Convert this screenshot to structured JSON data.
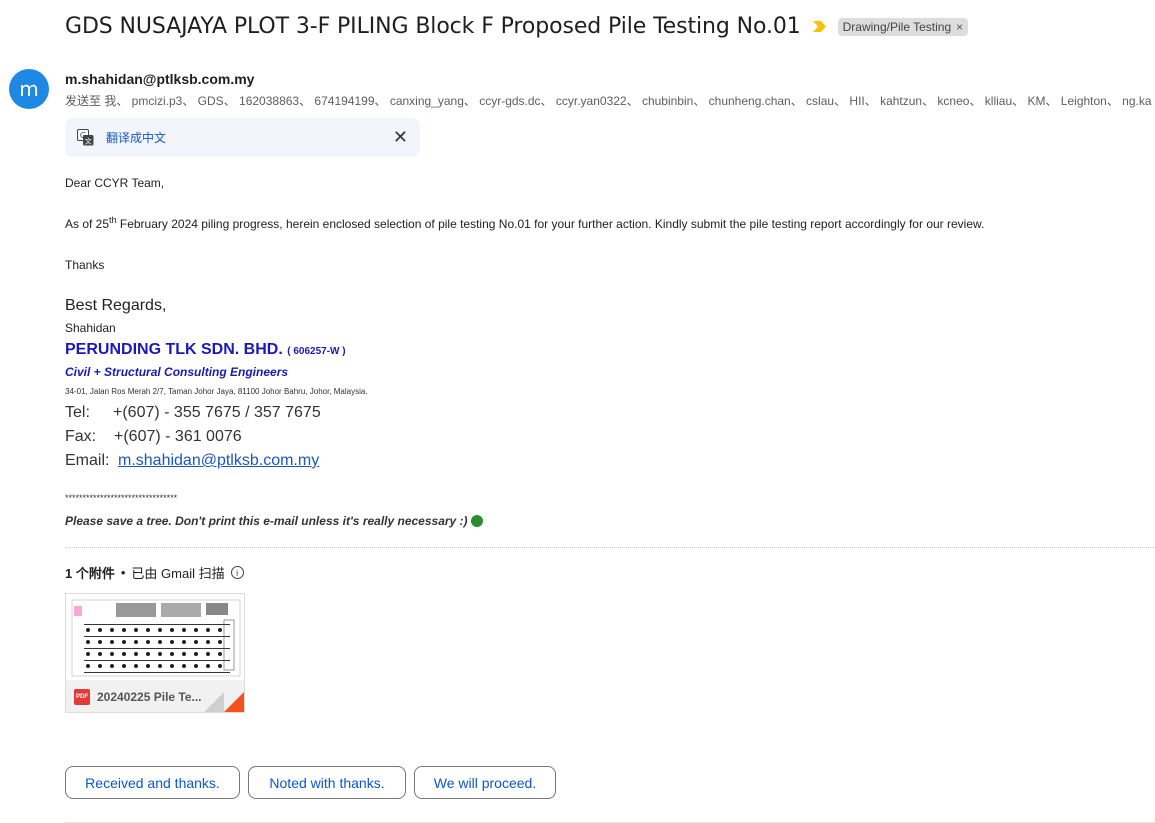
{
  "subject": "GDS NUSAJAYA PLOT 3-F PILING Block F Proposed Pile Testing No.01",
  "label": {
    "text": "Drawing/Pile Testing",
    "remove": "×"
  },
  "avatar_letter": "m",
  "sender": "m.shahidan@ptlksb.com.my",
  "recipients_line": "发送至 我、 pmcizi.p3、 GDS、 162038863、 674194199、 canxing_yang、 ccyr-gds.dc、 ccyr.yan0322、 chubinbin、 chunheng.chan、 cslau、 HII、 kahtzun、 kcneo、 klliau、 KM、 Leighton、 ng.ka",
  "translate": {
    "label": "翻译成中文",
    "close": "✕"
  },
  "body": {
    "greeting": "Dear CCYR Team,",
    "para_pre": "As of 25",
    "para_sup": "th",
    "para_post": " February 2024 piling progress, herein enclosed selection of pile testing No.01 for your further action. Kindly submit the pile testing report accordingly for our review.",
    "thanks": "Thanks"
  },
  "signature": {
    "regards": "Best Regards,",
    "name": "Shahidan",
    "company": "PERUNDING TLK SDN. BHD.",
    "reg_no": "( 606257-W )",
    "tagline": "Civil + Structural Consulting Engineers",
    "address": "34-01, Jalan Ros Merah 2/7, Taman Johor Jaya, 81100 Johor Bahru, Johor, Malaysia.",
    "tel_label": "Tel:",
    "tel": "+(607) - 355 7675 / 357 7675",
    "fax_label": "Fax:",
    "fax": "+(607) - 361 0076",
    "email_label": "Email:",
    "email": "m.shahidan@ptlksb.com.my",
    "stars": "********************************",
    "tree_note": "Please save a tree. Don't print this e-mail unless it's really necessary :)"
  },
  "attachments": {
    "count": "1 个附件",
    "separator": "•",
    "scan_note": "已由 Gmail 扫描",
    "info": "i",
    "file": {
      "name": "20240225 Pile Te...",
      "type": "PDF"
    }
  },
  "smart_replies": [
    "Received and thanks.",
    "Noted with thanks.",
    "We will proceed."
  ],
  "colors": {
    "avatar": "#1e88e5",
    "link": "#1a57c4",
    "company": "#1a1ab8",
    "important": "#f4c20d"
  }
}
